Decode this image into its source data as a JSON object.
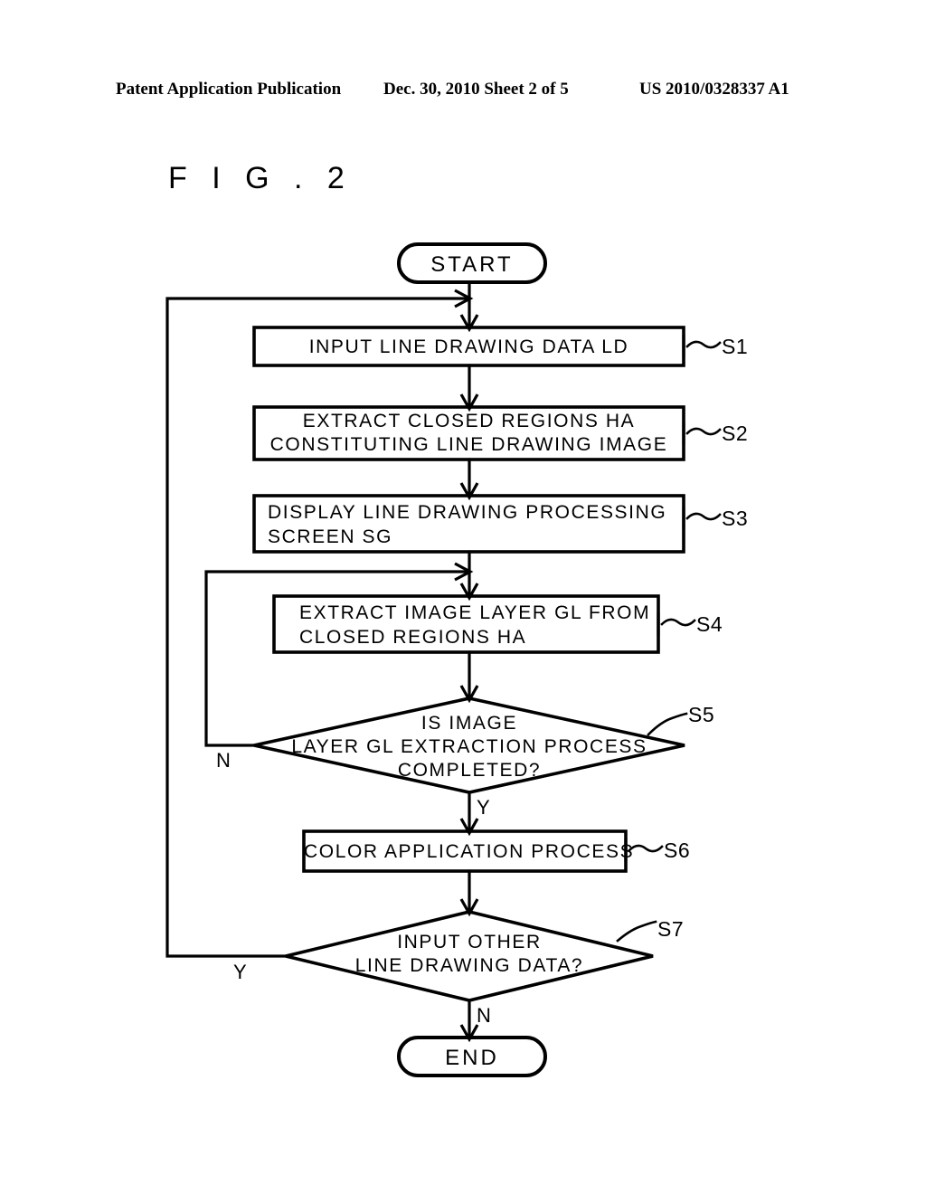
{
  "header": {
    "publication": "Patent Application Publication",
    "date_sheet": "Dec. 30, 2010   Sheet 2 of 5",
    "patent_number": "US 2010/0328337 A1"
  },
  "figure": {
    "label": "F I G . 2"
  },
  "flowchart": {
    "start": {
      "text": "START"
    },
    "end": {
      "text": "END"
    },
    "steps": [
      {
        "id": "S1",
        "ref": "S1",
        "shape": "process",
        "align": "center",
        "lines": [
          "INPUT LINE DRAWING DATA LD"
        ]
      },
      {
        "id": "S2",
        "ref": "S2",
        "shape": "process",
        "align": "center",
        "lines": [
          "EXTRACT CLOSED REGIONS HA",
          "CONSTITUTING LINE DRAWING IMAGE"
        ]
      },
      {
        "id": "S3",
        "ref": "S3",
        "shape": "process",
        "align": "left",
        "lines": [
          "DISPLAY LINE DRAWING PROCESSING",
          "SCREEN SG"
        ]
      },
      {
        "id": "S4",
        "ref": "S4",
        "shape": "process",
        "align": "left",
        "lines": [
          "EXTRACT IMAGE LAYER GL FROM",
          "CLOSED REGIONS HA"
        ]
      },
      {
        "id": "S5",
        "ref": "S5",
        "shape": "decision",
        "align": "center",
        "lines": [
          "IS IMAGE",
          "LAYER GL EXTRACTION PROCESS",
          "COMPLETED?"
        ]
      },
      {
        "id": "S6",
        "ref": "S6",
        "shape": "process",
        "align": "center",
        "lines": [
          "COLOR APPLICATION PROCESS"
        ]
      },
      {
        "id": "S7",
        "ref": "S7",
        "shape": "decision",
        "align": "center",
        "lines": [
          "INPUT OTHER",
          "LINE DRAWING DATA?"
        ]
      }
    ],
    "branch_labels": {
      "s5_no": "N",
      "s5_yes": "Y",
      "s7_yes": "Y",
      "s7_no": "N"
    }
  },
  "colors": {
    "ink": "#000000",
    "paper": "#ffffff"
  }
}
